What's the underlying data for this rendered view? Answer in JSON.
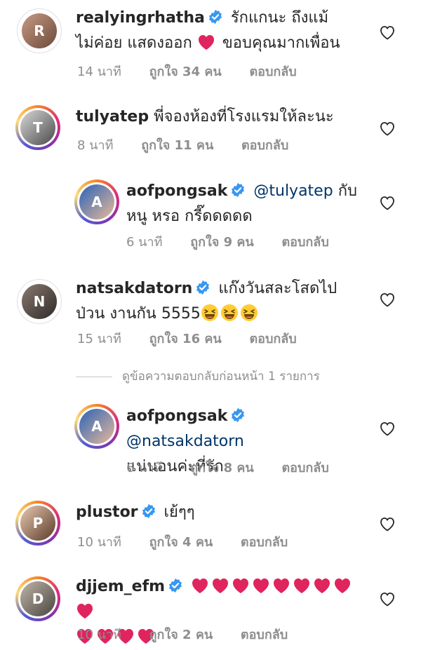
{
  "comments": [
    {
      "username": "realyingrhatha",
      "verified": true,
      "text_before": "รักแกนะ ถึงแม้ไม่ค่อย แสดงออก",
      "text_after": "ขอบคุณมากเพื่อน",
      "time": "14 นาที",
      "likes": "ถูกใจ 34 คน",
      "reply": "ตอบกลับ"
    },
    {
      "username": "tulyatep",
      "verified": false,
      "text": "พี่จองห้องที่โรงแรมให้ละนะ",
      "time": "8 นาที",
      "likes": "ถูกใจ 11 คน",
      "reply": "ตอบกลับ"
    },
    {
      "username": "aofpongsak",
      "verified": true,
      "mention": "@tulyatep",
      "text": "กับหนู หรอ กรี๊ดดดดด",
      "time": "6 นาที",
      "likes": "ถูกใจ 9 คน",
      "reply": "ตอบกลับ"
    },
    {
      "username": "natsakdatorn",
      "verified": true,
      "text": "แก๊งวันสละโสดไปป่วน งานกัน 5555",
      "time": "15 นาที",
      "likes": "ถูกใจ 16 คน",
      "reply": "ตอบกลับ"
    },
    {
      "username": "aofpongsak",
      "verified": true,
      "mention": "@natsakdatorn",
      "text": "แน่นอนค่ะที่รัก",
      "time": "6 นาที",
      "likes": "ถูกใจ 8 คน",
      "reply": "ตอบกลับ"
    },
    {
      "username": "plustor",
      "verified": true,
      "text": "เย้ๆๆ",
      "time": "10 นาที",
      "likes": "ถูกใจ 4 คน",
      "reply": "ตอบกลับ"
    },
    {
      "username": "djjem_efm",
      "verified": true,
      "text": "",
      "time": "10 นาที",
      "likes": "ถูกใจ 2 คน",
      "reply": "ตอบกลับ"
    }
  ],
  "view_previous_replies": "ดูข้อความตอบกลับก่อนหน้า 1 รายการ",
  "icons": {
    "like": "heart-outline-icon",
    "verified": "verified-badge-icon",
    "red_heart": "red-heart-icon",
    "laugh": "grinning-squinting-face-icon"
  },
  "colors": {
    "verified_blue": "#3897f0",
    "heart_red": "#e0245e",
    "meta_gray": "#8e8e8e",
    "mention_blue": "#003569"
  }
}
